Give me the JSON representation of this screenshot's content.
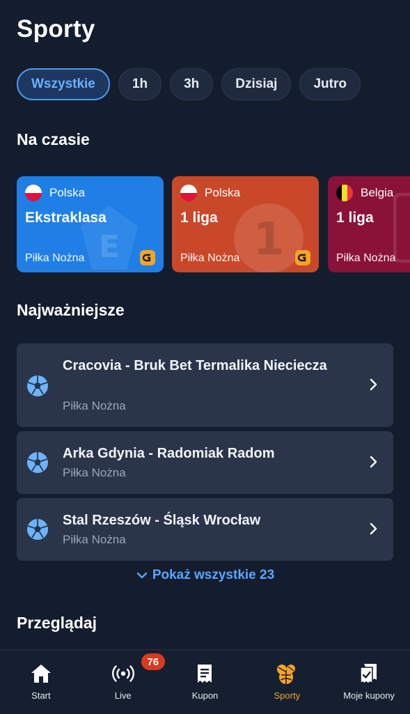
{
  "header": {
    "title": "Sporty"
  },
  "filters": [
    {
      "label": "Wszystkie",
      "active": true
    },
    {
      "label": "1h",
      "active": false
    },
    {
      "label": "3h",
      "active": false
    },
    {
      "label": "Dzisiaj",
      "active": false
    },
    {
      "label": "Jutro",
      "active": false
    }
  ],
  "trending": {
    "title": "Na czasie",
    "cards": [
      {
        "country": "Polska",
        "league": "Ekstraklasa",
        "sport": "Piłka Nożna",
        "color": "#1f7fe6",
        "flag": "pl-flag-icon",
        "watermark": "E"
      },
      {
        "country": "Polska",
        "league": "1 liga",
        "sport": "Piłka Nożna",
        "color": "#c9482a",
        "flag": "pl-flag-icon",
        "watermark": "1"
      },
      {
        "country": "Belgia",
        "league": "1 liga",
        "sport": "Piłka Nożna",
        "color": "#8a1238",
        "flag": "be-flag-icon"
      }
    ]
  },
  "highlights": {
    "title": "Najważniejsze",
    "matches": [
      {
        "title": "Cracovia - Bruk Bet Termalika Nieciecza",
        "sport": "Piłka Nożna"
      },
      {
        "title": "Arka Gdynia - Radomiak Radom",
        "sport": "Piłka Nożna"
      },
      {
        "title": "Stal Rzeszów - Śląsk Wrocław",
        "sport": "Piłka Nożna"
      }
    ],
    "show_all": "Pokaż wszystkie 23"
  },
  "browse": {
    "title": "Przeglądaj"
  },
  "nav": {
    "items": [
      {
        "label": "Start",
        "icon": "home-icon"
      },
      {
        "label": "Live",
        "icon": "live-icon",
        "badge": "76"
      },
      {
        "label": "Kupon",
        "icon": "coupon-icon"
      },
      {
        "label": "Sporty",
        "icon": "sports-icon",
        "active": true
      },
      {
        "label": "Moje kupony",
        "icon": "my-coupons-icon"
      }
    ]
  },
  "colors": {
    "background": "#141d2e",
    "accent": "#4d9af5",
    "active_nav": "#f5a524",
    "badge": "#d83a1f"
  }
}
